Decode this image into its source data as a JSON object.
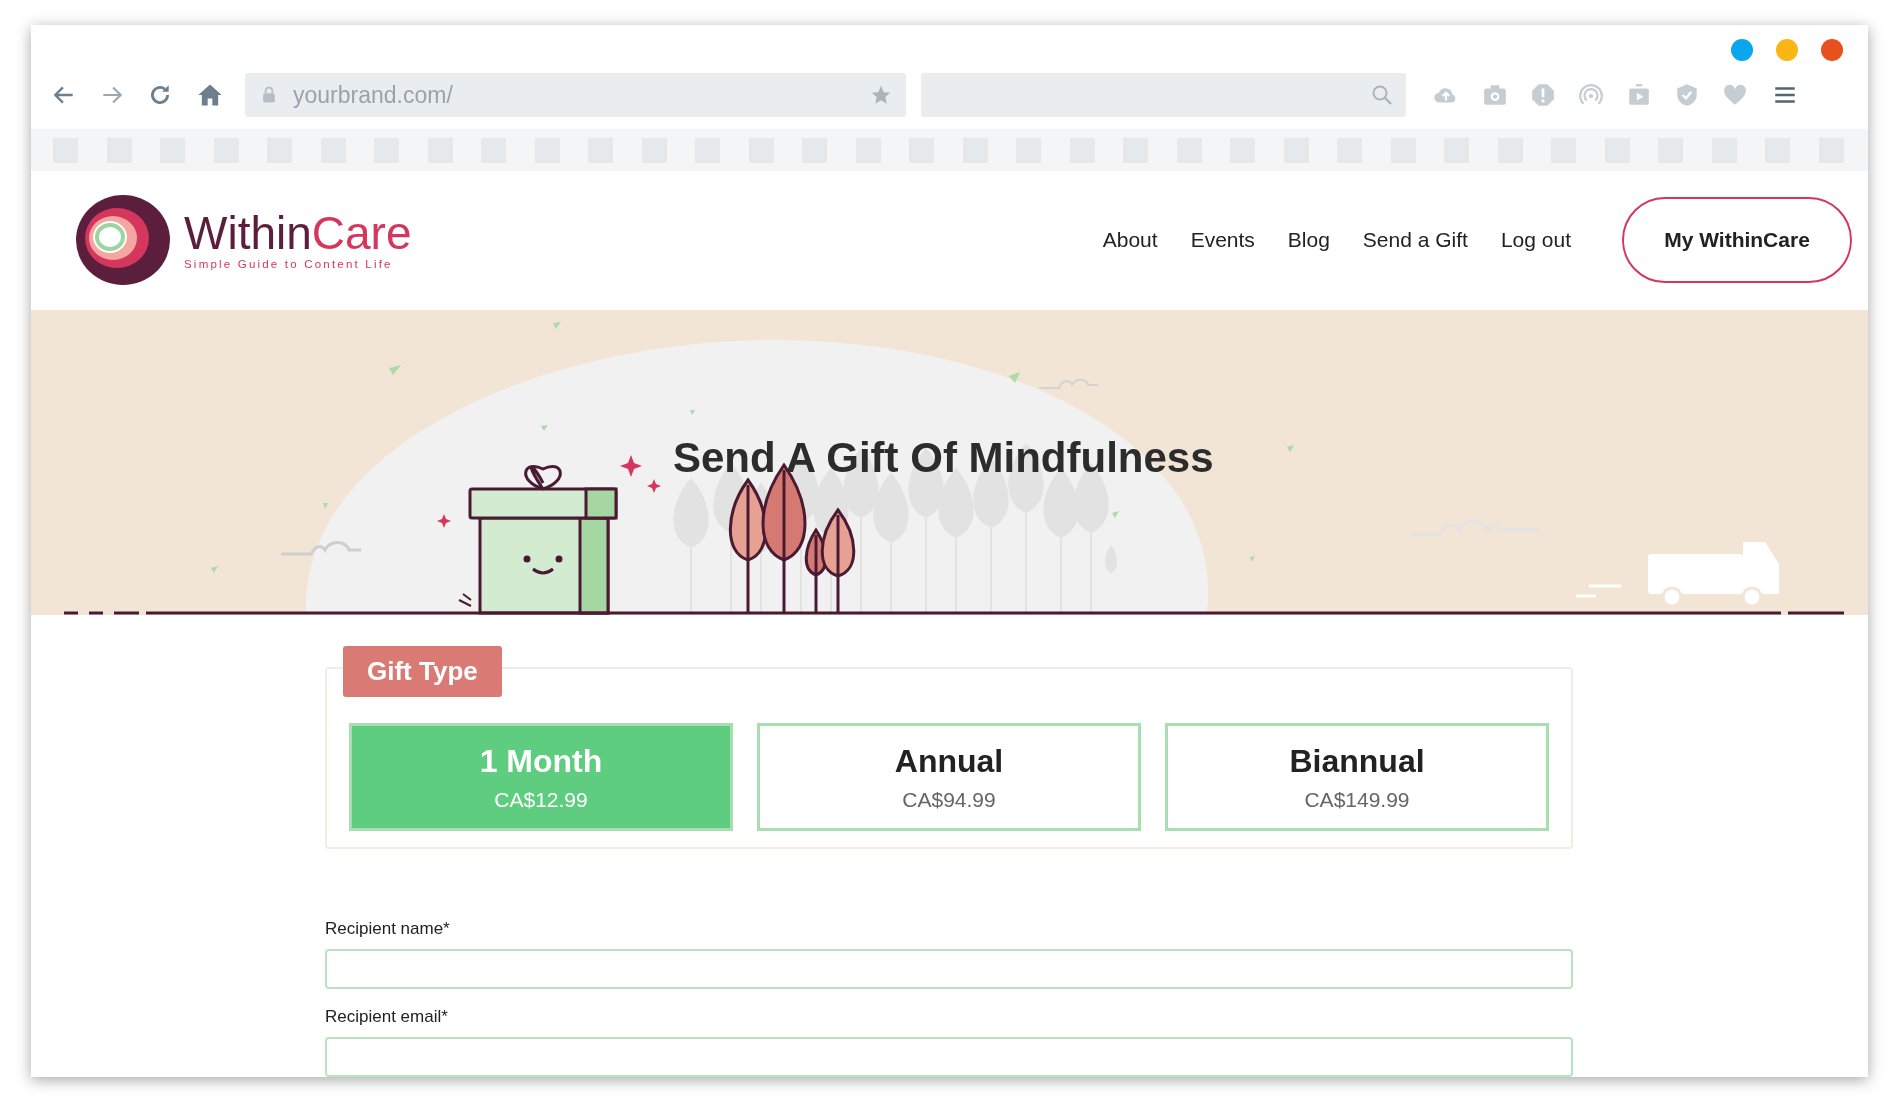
{
  "browser": {
    "url": "yourbrand.com/",
    "dots": [
      {
        "color": "#0aa6ef"
      },
      {
        "color": "#fbb613"
      },
      {
        "color": "#e8501f"
      }
    ]
  },
  "site": {
    "logo": {
      "name_parts": [
        "Within",
        "Care"
      ],
      "tagline": "Simple Guide to Content Life"
    },
    "nav": [
      "About",
      "Events",
      "Blog",
      "Send a Gift",
      "Log out"
    ],
    "account_button": "My WithinCare"
  },
  "hero": {
    "title": "Send A Gift Of Mindfulness"
  },
  "gift_type": {
    "legend": "Gift Type",
    "options": [
      {
        "title": "1 Month",
        "price": "CA$12.99",
        "selected": true
      },
      {
        "title": "Annual",
        "price": "CA$94.99",
        "selected": false
      },
      {
        "title": "Biannual",
        "price": "CA$149.99",
        "selected": false
      }
    ]
  },
  "fields": [
    {
      "label": "Recipient name*"
    },
    {
      "label": "Recipient email*"
    }
  ]
}
